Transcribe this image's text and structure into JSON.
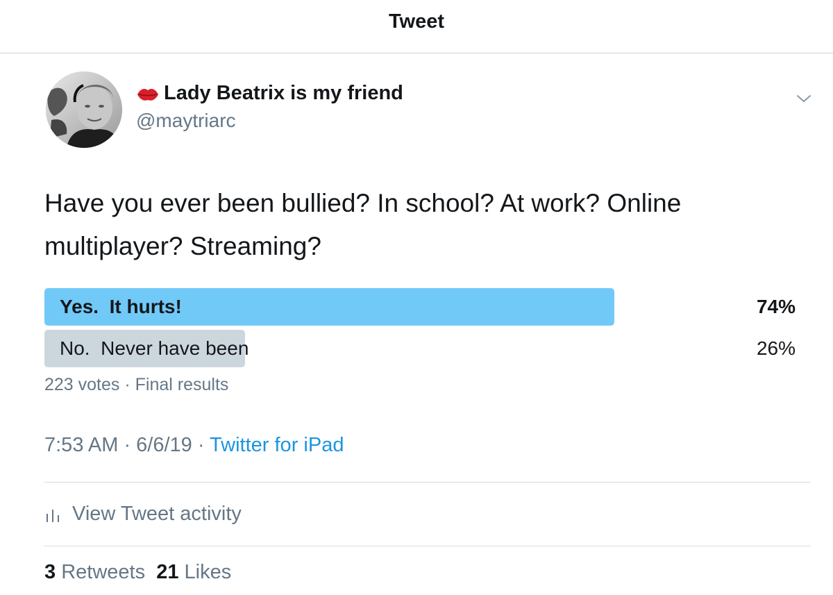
{
  "header": {
    "title": "Tweet"
  },
  "author": {
    "display_name": "Lady Beatrix is my friend",
    "emoji_icon": "lips-icon",
    "handle": "@maytriarc"
  },
  "tweet": {
    "text": "Have you ever been bullied?  In school? At work? Online multiplayer?  Streaming?"
  },
  "poll": {
    "options": [
      {
        "label": "Yes.  It hurts!",
        "percent_text": "74%",
        "percent": 74,
        "color": "#71c9f8",
        "winner": true
      },
      {
        "label": "No.  Never have been",
        "percent_text": "26%",
        "percent": 26,
        "color": "#ccd6dd",
        "winner": false
      }
    ],
    "meta": "223 votes · Final results"
  },
  "timestamp": {
    "time_date": "7:53 AM · 6/6/19 · ",
    "source": "Twitter for iPad"
  },
  "activity": {
    "label": "View Tweet activity",
    "icon": "bar-chart-icon"
  },
  "stats": {
    "retweets_count": "3",
    "retweets_label": "Retweets",
    "likes_count": "21",
    "likes_label": "Likes"
  },
  "colors": {
    "link_blue": "#1b95e0",
    "secondary_text": "#657786",
    "poll_winner": "#71c9f8",
    "poll_other": "#ccd6dd"
  }
}
